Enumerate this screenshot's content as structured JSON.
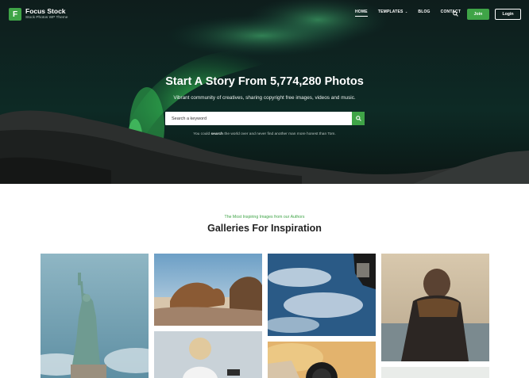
{
  "brand": {
    "logo_letter": "F",
    "name": "Focus Stock",
    "tagline": "Stock Photos WP Theme",
    "accent": "#3fa447"
  },
  "nav": {
    "items": [
      {
        "label": "HOME",
        "active": true
      },
      {
        "label": "TEMPLATES",
        "has_dropdown": true
      },
      {
        "label": "BLOG"
      },
      {
        "label": "CONTACT"
      }
    ],
    "search_icon": "search-icon",
    "join_label": "Join",
    "login_label": "Login"
  },
  "hero": {
    "title": "Start A Story From 5,774,280 Photos",
    "subtitle": "Vibrant community of creatives, sharing copyright free images, videos and music.",
    "search_placeholder": "Search a keyword",
    "note_before": "You could",
    "note_bold": "search",
    "note_after": "the world over and never find another man more honest than Tom."
  },
  "gallery": {
    "kicker": "The Most Inspiring Images from our Authors",
    "title": "Galleries For Inspiration",
    "images": [
      {
        "subject": "statue-of-liberty"
      },
      {
        "subject": "two-camels"
      },
      {
        "subject": "earth-from-space-satellite"
      },
      {
        "subject": "man-in-scarf-by-sea"
      },
      {
        "subject": "girl-with-phone"
      },
      {
        "subject": "camera-lens"
      },
      {
        "subject": "partial-image"
      }
    ]
  }
}
